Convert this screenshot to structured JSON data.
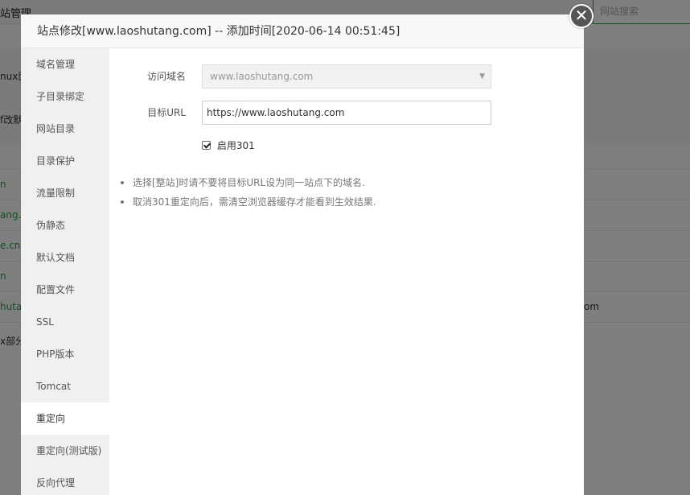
{
  "background": {
    "title": "站管理",
    "search_placeholder": "网站搜索",
    "fragments": [
      "nux面",
      "f改默",
      "n",
      "ang.c",
      "e.cn",
      "n",
      "hutar",
      "x部分"
    ],
    "right_fragment": "om"
  },
  "modal": {
    "title": "站点修改[www.laoshutang.com] -- 添加时间[2020-06-14 00:51:45]",
    "close_icon": "✕"
  },
  "sidebar": {
    "items": [
      {
        "label": "域名管理",
        "active": false
      },
      {
        "label": "子目录绑定",
        "active": false
      },
      {
        "label": "网站目录",
        "active": false
      },
      {
        "label": "目录保护",
        "active": false
      },
      {
        "label": "流量限制",
        "active": false
      },
      {
        "label": "伪静态",
        "active": false
      },
      {
        "label": "默认文档",
        "active": false
      },
      {
        "label": "配置文件",
        "active": false
      },
      {
        "label": "SSL",
        "active": false
      },
      {
        "label": "PHP版本",
        "active": false
      },
      {
        "label": "Tomcat",
        "active": false
      },
      {
        "label": "重定向",
        "active": true
      },
      {
        "label": "重定向(测试版)",
        "active": false
      },
      {
        "label": "反向代理",
        "active": false
      }
    ]
  },
  "form": {
    "domain_label": "访问域名",
    "domain_value": "www.laoshutang.com",
    "target_label": "目标URL",
    "target_value": "https://www.laoshutang.com",
    "enable_label": "启用301",
    "enable_checked": true
  },
  "tips": [
    "选择[整站]时请不要将目标URL设为同一站点下的域名.",
    "取消301重定向后，需清空浏览器缓存才能看到生效结果."
  ],
  "colors": {
    "accent_green": "#20a53a",
    "overlay": "#000000"
  }
}
